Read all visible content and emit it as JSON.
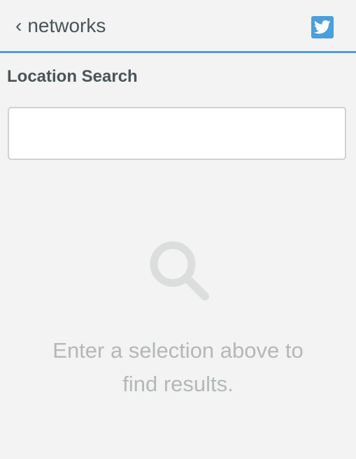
{
  "header": {
    "back_chevron": "‹",
    "back_label": "networks",
    "network_icon": "twitter-icon",
    "accent_color": "#4a9fdc"
  },
  "search": {
    "label": "Location Search",
    "value": "",
    "placeholder": ""
  },
  "empty_state": {
    "icon": "magnifier-icon",
    "line1": "Enter a selection above to",
    "line2": "find results."
  }
}
